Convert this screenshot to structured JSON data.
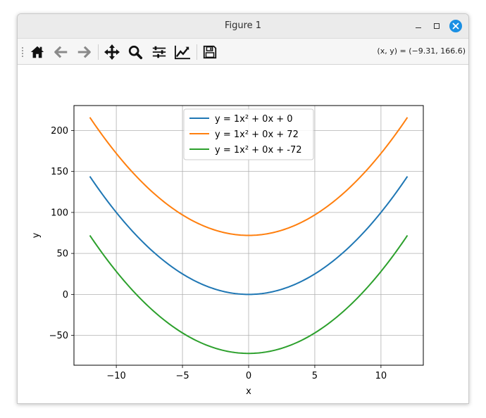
{
  "window": {
    "title": "Figure 1"
  },
  "toolbar": {
    "tools": [
      {
        "name": "home-icon",
        "label": "Home"
      },
      {
        "name": "back-icon",
        "label": "Back"
      },
      {
        "name": "forward-icon",
        "label": "Forward"
      },
      {
        "name": "pan-icon",
        "label": "Pan"
      },
      {
        "name": "zoom-icon",
        "label": "Zoom"
      },
      {
        "name": "configure-subplots-icon",
        "label": "Configure subplots"
      },
      {
        "name": "edit-axis-icon",
        "label": "Edit axis"
      },
      {
        "name": "save-icon",
        "label": "Save"
      }
    ],
    "coords": "(x, y) = (−9.31, 166.6)"
  },
  "chart_data": {
    "type": "line",
    "title": "",
    "xlabel": "x",
    "ylabel": "y",
    "xlim": [
      -13.2,
      13.2
    ],
    "ylim": [
      -86.4,
      230.4
    ],
    "xticks": [
      -10,
      -5,
      0,
      5,
      10
    ],
    "xtick_labels": [
      "−10",
      "−5",
      "0",
      "5",
      "10"
    ],
    "yticks": [
      -50,
      0,
      50,
      100,
      150,
      200
    ],
    "ytick_labels": [
      "−50",
      "0",
      "50",
      "100",
      "150",
      "200"
    ],
    "grid": true,
    "legend_position": "top-center",
    "x_range": [
      -12,
      12
    ],
    "series": [
      {
        "name": "y = 1x² + 0x + 0",
        "color": "#1f77b4",
        "a": 1,
        "b": 0,
        "c": 0,
        "x": [
          -12,
          -10,
          -8,
          -6,
          -4,
          -2,
          0,
          2,
          4,
          6,
          8,
          10,
          12
        ],
        "y": [
          144,
          100,
          64,
          36,
          16,
          4,
          0,
          4,
          16,
          36,
          64,
          100,
          144
        ]
      },
      {
        "name": "y = 1x² + 0x + 72",
        "color": "#ff7f0e",
        "a": 1,
        "b": 0,
        "c": 72,
        "x": [
          -12,
          -10,
          -8,
          -6,
          -4,
          -2,
          0,
          2,
          4,
          6,
          8,
          10,
          12
        ],
        "y": [
          216,
          172,
          136,
          108,
          88,
          76,
          72,
          76,
          88,
          108,
          136,
          172,
          216
        ]
      },
      {
        "name": "y = 1x² + 0x + -72",
        "color": "#2ca02c",
        "a": 1,
        "b": 0,
        "c": -72,
        "x": [
          -12,
          -10,
          -8,
          -6,
          -4,
          -2,
          0,
          2,
          4,
          6,
          8,
          10,
          12
        ],
        "y": [
          72,
          28,
          -8,
          -36,
          -56,
          -68,
          -72,
          -68,
          -56,
          -36,
          -8,
          28,
          72
        ]
      }
    ]
  }
}
